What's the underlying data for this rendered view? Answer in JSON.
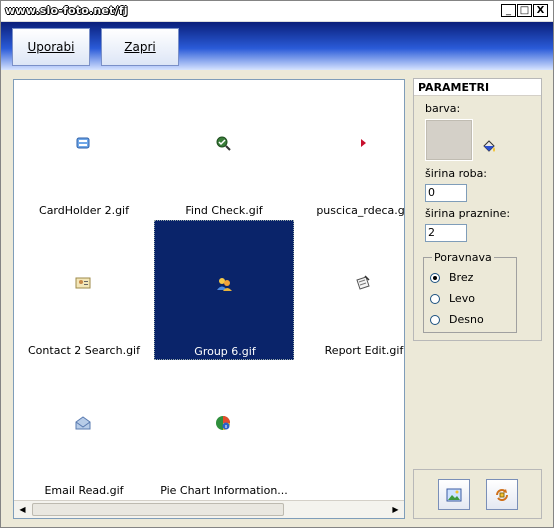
{
  "window": {
    "title": "www.slo-foto.net/fj",
    "min_glyph": "_",
    "max_glyph": "□",
    "close_glyph": "X"
  },
  "toolbar": {
    "uporabi_label": "Uporabi",
    "zapri_label": "Zapri"
  },
  "gallery": {
    "items": [
      {
        "label": "CardHolder 2.gif",
        "icon": "cardholder-icon",
        "selected": false
      },
      {
        "label": "Find Check.gif",
        "icon": "find-check-icon",
        "selected": false
      },
      {
        "label": "puscica_rdeca.gif",
        "icon": "red-arrow-icon",
        "selected": false
      },
      {
        "label": "Contact 2 Search.gif",
        "icon": "contact-search-icon",
        "selected": false
      },
      {
        "label": "Group 6.gif",
        "icon": "group-icon",
        "selected": true
      },
      {
        "label": "Report Edit.gif",
        "icon": "report-edit-icon",
        "selected": false
      },
      {
        "label": "Email Read.gif",
        "icon": "email-read-icon",
        "selected": false
      },
      {
        "label": "Pie Chart Information...",
        "icon": "pie-chart-info-icon",
        "selected": false
      }
    ]
  },
  "params": {
    "title": "PARAMETRI",
    "color_label": "barva:",
    "color_value": "#d4d0c8",
    "border_width_label": "širina roba:",
    "border_width_value": "0",
    "spacing_label": "širina praznine:",
    "spacing_value": "2",
    "align_group_label": "Poravnava",
    "align_options": [
      "Brez",
      "Levo",
      "Desno"
    ],
    "align_selected": "Brez"
  },
  "colors": {
    "selection": "#0a246a",
    "toolbar_top": "#0a1f7a",
    "panel_bg": "#ece9d8"
  }
}
